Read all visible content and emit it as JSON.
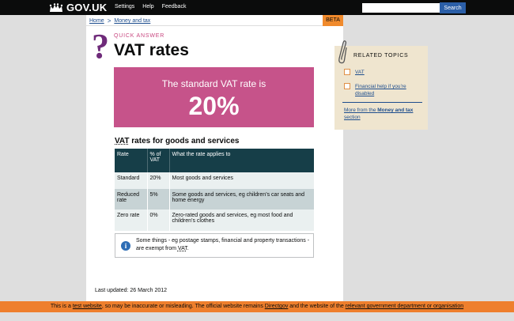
{
  "header": {
    "logo_text": "GOV.UK",
    "nav": [
      "Settings",
      "Help",
      "Feedback"
    ],
    "search_placeholder": "",
    "search_button": "Search"
  },
  "breadcrumb": {
    "items": [
      "Home",
      "Money and tax"
    ],
    "separator": ">"
  },
  "beta_label": "BETA",
  "page": {
    "kicker": "QUICK ANSWER",
    "title": "VAT rates",
    "hero_lead": "The standard VAT rate is",
    "hero_value": "20%",
    "subheading": "VAT rates for goods and services",
    "subheading_abbr": "VAT",
    "subheading_rest": " rates for goods and services",
    "table": {
      "headers": [
        "Rate",
        "% of VAT",
        "What the rate applies to"
      ],
      "rows": [
        [
          "Standard",
          "20%",
          "Most goods and services"
        ],
        [
          "Reduced rate",
          "5%",
          "Some goods and services, eg children’s car seats and home energy"
        ],
        [
          "Zero rate",
          "0%",
          "Zero-rated goods and services, eg most food and children’s clothes"
        ]
      ]
    },
    "note": {
      "text_before": "Some things - eg postage stamps, financial and property transactions - are exempt from ",
      "abbr": "VAT",
      "text_after": "."
    },
    "last_updated": "Last updated: 26 March 2012"
  },
  "related": {
    "heading": "RELATED TOPICS",
    "items": [
      "VAT",
      "Financial help if you’re disabled"
    ],
    "more_prefix": "More from the ",
    "more_section": "Money and tax",
    "more_suffix": " section"
  },
  "footer": {
    "t1": "This is a ",
    "link1": "test website",
    "t2": ", so may be inaccurate or misleading. The official website remains ",
    "link2": "Directgov",
    "t3": " and the website of the ",
    "link3": "relevant government department or organisation"
  },
  "colors": {
    "topbar": "#0b0c0c",
    "hero": "#c6538a",
    "table_header": "#163e48",
    "aside": "#efe5cf",
    "footer": "#ee7f2d",
    "link": "#1d4d8d"
  },
  "icons": [
    "crown-icon",
    "question-mark-icon",
    "paperclip-icon",
    "info-icon"
  ]
}
